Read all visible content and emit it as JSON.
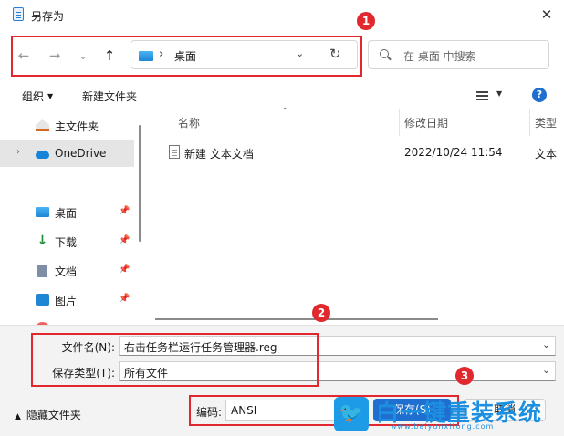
{
  "window": {
    "title": "另存为",
    "close_glyph": "✕"
  },
  "nav": {
    "back_glyph": "←",
    "forward_glyph": "→",
    "recent_glyph": "⌄",
    "up_glyph": "↑",
    "address": {
      "separator": "›",
      "path": "桌面",
      "dropdown_glyph": "⌄",
      "refresh_glyph": "↻"
    },
    "search": {
      "placeholder": "在 桌面 中搜索"
    }
  },
  "toolbar": {
    "organize": "组织",
    "new_folder": "新建文件夹",
    "help": "?"
  },
  "sidebar": {
    "items": [
      {
        "label": "主文件夹",
        "icon": "home-icon"
      },
      {
        "label": "OneDrive",
        "icon": "onedrive-icon",
        "expander": "›"
      },
      {
        "label": "桌面",
        "icon": "desktop-icon",
        "pin": "📌"
      },
      {
        "label": "下载",
        "icon": "download-icon",
        "pin": "📌"
      },
      {
        "label": "文档",
        "icon": "document-icon",
        "pin": "📌"
      },
      {
        "label": "图片",
        "icon": "picture-icon",
        "pin": "📌"
      }
    ]
  },
  "file_list": {
    "sort_glyph": "⌃",
    "columns": {
      "name": "名称",
      "modified": "修改日期",
      "type": "类型"
    },
    "rows": [
      {
        "name": "新建 文本文档",
        "modified": "2022/10/24 11:54",
        "type": "文本"
      }
    ]
  },
  "form": {
    "filename_label": "文件名(N):",
    "filename_value": "右击任务栏运行任务管理器.reg",
    "filetype_label": "保存类型(T):",
    "filetype_value": "所有文件",
    "dropdown_glyph": "⌄"
  },
  "footer": {
    "hide_folders": "隐藏文件夹",
    "hide_caret": "▲",
    "encoding_label": "编码:",
    "encoding_value": "ANSI",
    "save_button": "保存(S)",
    "cancel_button": "取消"
  },
  "annotations": {
    "n1": "1",
    "n2": "2",
    "n3": "3"
  },
  "watermark": {
    "text": "白一键重装系统",
    "url": "www.baiyunxitong.com"
  },
  "colors": {
    "accent": "#1f6fd0",
    "annotation": "#e0282e",
    "watermark": "#1d8fe0"
  }
}
